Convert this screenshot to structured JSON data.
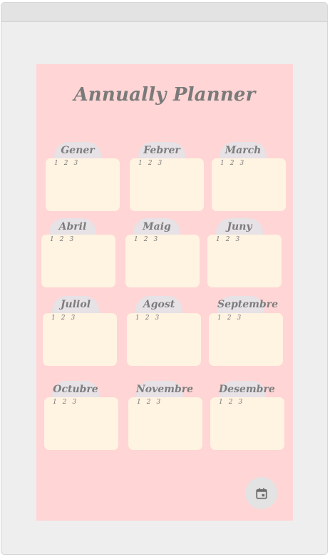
{
  "title": "Annually Planner",
  "day_numbers": [
    "1",
    "2",
    "3"
  ],
  "months": [
    {
      "label": "Gener"
    },
    {
      "label": "Febrer"
    },
    {
      "label": "March"
    },
    {
      "label": "Abril"
    },
    {
      "label": "Maig"
    },
    {
      "label": "Juny"
    },
    {
      "label": "Juliol"
    },
    {
      "label": "Agost"
    },
    {
      "label": "Septembre"
    },
    {
      "label": "Octubre"
    },
    {
      "label": "Novembre"
    },
    {
      "label": "Desembre"
    }
  ],
  "fab_icon": "calendar-icon",
  "colors": {
    "page_bg": "#ffd5d5",
    "card_bg": "#fff3e1",
    "tab_bg": "#e6e2e6",
    "text": "#7a7a7a"
  }
}
